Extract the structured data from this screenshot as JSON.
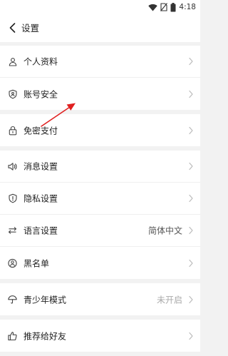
{
  "status_bar": {
    "time": "4:18"
  },
  "header": {
    "title": "设置"
  },
  "groups": [
    {
      "items": [
        {
          "label": "个人资料",
          "icon": "person-icon"
        },
        {
          "label": "账号安全",
          "icon": "shield-icon"
        }
      ]
    },
    {
      "items": [
        {
          "label": "免密支付",
          "icon": "lock-icon"
        }
      ]
    },
    {
      "items": [
        {
          "label": "消息设置",
          "icon": "speaker-icon"
        },
        {
          "label": "隐私设置",
          "icon": "privacy-shield-icon"
        },
        {
          "label": "语言设置",
          "icon": "swap-arrows-icon",
          "value": "简体中文"
        },
        {
          "label": "黑名单",
          "icon": "blocked-user-icon"
        }
      ]
    },
    {
      "items": [
        {
          "label": "青少年模式",
          "icon": "umbrella-icon",
          "value": "未开启"
        }
      ]
    },
    {
      "items": [
        {
          "label": "推荐给好友",
          "icon": "thumbs-up-icon"
        }
      ]
    }
  ],
  "annotation": {
    "type": "red-arrow",
    "color": "#e02020"
  }
}
